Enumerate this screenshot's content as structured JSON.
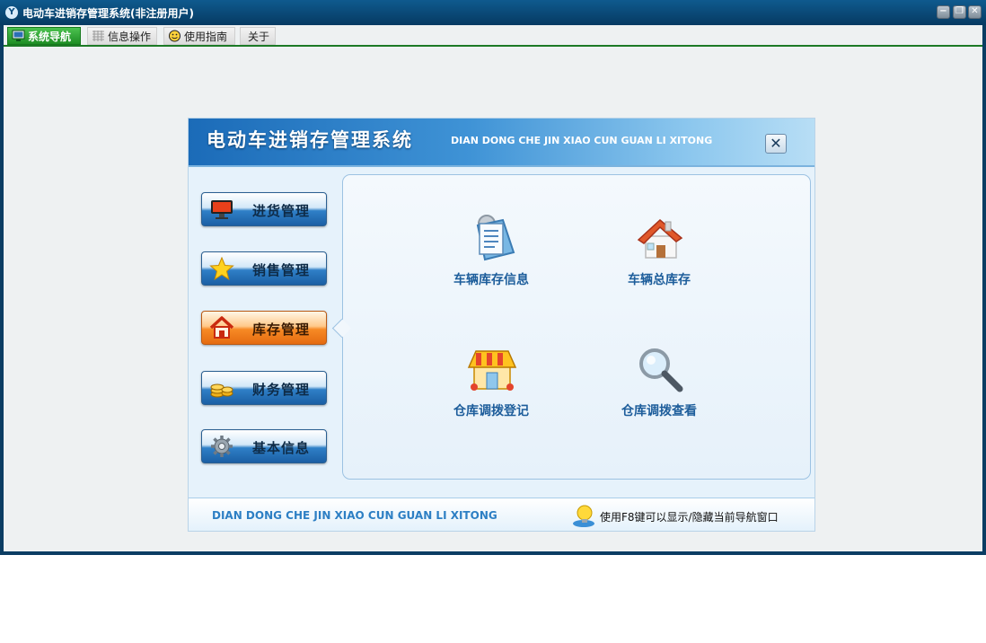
{
  "window": {
    "title": "电动车进销存管理系统(非注册用户)",
    "app_icon": "app-logo-icon",
    "controls": {
      "minimize": "−",
      "restore": "❐",
      "close": "✕"
    }
  },
  "tabs": [
    {
      "label": "系统导航",
      "icon": "monitor-icon",
      "active": true
    },
    {
      "label": "信息操作",
      "icon": "grid-icon",
      "active": false
    },
    {
      "label": "使用指南",
      "icon": "smile-icon",
      "active": false
    },
    {
      "label": "关于",
      "icon": "",
      "active": false
    }
  ],
  "nav": {
    "title": "电动车进销存管理系统",
    "subtitle": "DIAN DONG CHE JIN XIAO CUN GUAN LI XITONG",
    "close": "✕",
    "menu": [
      {
        "label": "进货管理",
        "icon": "monitor-icon",
        "active": false
      },
      {
        "label": "销售管理",
        "icon": "star-icon",
        "active": false
      },
      {
        "label": "库存管理",
        "icon": "home-icon",
        "active": true
      },
      {
        "label": "财务管理",
        "icon": "coins-icon",
        "active": false
      },
      {
        "label": "基本信息",
        "icon": "gear-icon",
        "active": false
      }
    ],
    "items": [
      {
        "label": "车辆库存信息",
        "icon": "document-list-icon"
      },
      {
        "label": "车辆总库存",
        "icon": "house-icon"
      },
      {
        "label": "仓库调拨登记",
        "icon": "shop-icon"
      },
      {
        "label": "仓库调拨查看",
        "icon": "magnifier-icon"
      }
    ],
    "footer": {
      "subtitle": "DIAN DONG CHE JIN XIAO CUN GUAN LI XITONG",
      "hint": "使用F8键可以显示/隐藏当前导航窗口"
    }
  },
  "colors": {
    "accent_green": "#1d8c24",
    "title_blue": "#0b3d63",
    "item_label": "#1d5d9b",
    "active_orange": "#f78a25"
  }
}
